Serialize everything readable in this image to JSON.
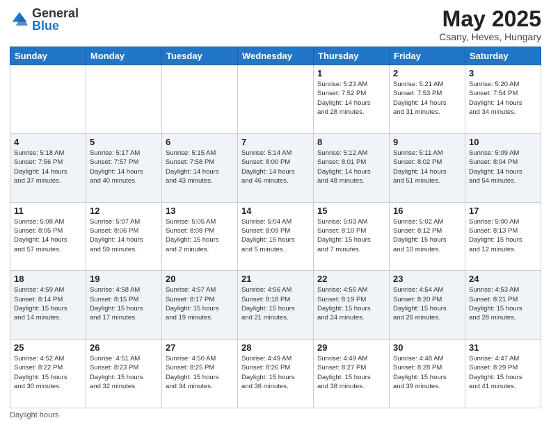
{
  "header": {
    "logo_general": "General",
    "logo_blue": "Blue",
    "month_title": "May 2025",
    "subtitle": "Csany, Heves, Hungary"
  },
  "footer": {
    "daylight_label": "Daylight hours"
  },
  "weekdays": [
    "Sunday",
    "Monday",
    "Tuesday",
    "Wednesday",
    "Thursday",
    "Friday",
    "Saturday"
  ],
  "weeks": [
    [
      {
        "day": "",
        "info": ""
      },
      {
        "day": "",
        "info": ""
      },
      {
        "day": "",
        "info": ""
      },
      {
        "day": "",
        "info": ""
      },
      {
        "day": "1",
        "info": "Sunrise: 5:23 AM\nSunset: 7:52 PM\nDaylight: 14 hours\nand 28 minutes."
      },
      {
        "day": "2",
        "info": "Sunrise: 5:21 AM\nSunset: 7:53 PM\nDaylight: 14 hours\nand 31 minutes."
      },
      {
        "day": "3",
        "info": "Sunrise: 5:20 AM\nSunset: 7:54 PM\nDaylight: 14 hours\nand 34 minutes."
      }
    ],
    [
      {
        "day": "4",
        "info": "Sunrise: 5:18 AM\nSunset: 7:56 PM\nDaylight: 14 hours\nand 37 minutes."
      },
      {
        "day": "5",
        "info": "Sunrise: 5:17 AM\nSunset: 7:57 PM\nDaylight: 14 hours\nand 40 minutes."
      },
      {
        "day": "6",
        "info": "Sunrise: 5:15 AM\nSunset: 7:58 PM\nDaylight: 14 hours\nand 43 minutes."
      },
      {
        "day": "7",
        "info": "Sunrise: 5:14 AM\nSunset: 8:00 PM\nDaylight: 14 hours\nand 46 minutes."
      },
      {
        "day": "8",
        "info": "Sunrise: 5:12 AM\nSunset: 8:01 PM\nDaylight: 14 hours\nand 48 minutes."
      },
      {
        "day": "9",
        "info": "Sunrise: 5:11 AM\nSunset: 8:02 PM\nDaylight: 14 hours\nand 51 minutes."
      },
      {
        "day": "10",
        "info": "Sunrise: 5:09 AM\nSunset: 8:04 PM\nDaylight: 14 hours\nand 54 minutes."
      }
    ],
    [
      {
        "day": "11",
        "info": "Sunrise: 5:08 AM\nSunset: 8:05 PM\nDaylight: 14 hours\nand 57 minutes."
      },
      {
        "day": "12",
        "info": "Sunrise: 5:07 AM\nSunset: 8:06 PM\nDaylight: 14 hours\nand 59 minutes."
      },
      {
        "day": "13",
        "info": "Sunrise: 5:05 AM\nSunset: 8:08 PM\nDaylight: 15 hours\nand 2 minutes."
      },
      {
        "day": "14",
        "info": "Sunrise: 5:04 AM\nSunset: 8:09 PM\nDaylight: 15 hours\nand 5 minutes."
      },
      {
        "day": "15",
        "info": "Sunrise: 5:03 AM\nSunset: 8:10 PM\nDaylight: 15 hours\nand 7 minutes."
      },
      {
        "day": "16",
        "info": "Sunrise: 5:02 AM\nSunset: 8:12 PM\nDaylight: 15 hours\nand 10 minutes."
      },
      {
        "day": "17",
        "info": "Sunrise: 5:00 AM\nSunset: 8:13 PM\nDaylight: 15 hours\nand 12 minutes."
      }
    ],
    [
      {
        "day": "18",
        "info": "Sunrise: 4:59 AM\nSunset: 8:14 PM\nDaylight: 15 hours\nand 14 minutes."
      },
      {
        "day": "19",
        "info": "Sunrise: 4:58 AM\nSunset: 8:15 PM\nDaylight: 15 hours\nand 17 minutes."
      },
      {
        "day": "20",
        "info": "Sunrise: 4:57 AM\nSunset: 8:17 PM\nDaylight: 15 hours\nand 19 minutes."
      },
      {
        "day": "21",
        "info": "Sunrise: 4:56 AM\nSunset: 8:18 PM\nDaylight: 15 hours\nand 21 minutes."
      },
      {
        "day": "22",
        "info": "Sunrise: 4:55 AM\nSunset: 8:19 PM\nDaylight: 15 hours\nand 24 minutes."
      },
      {
        "day": "23",
        "info": "Sunrise: 4:54 AM\nSunset: 8:20 PM\nDaylight: 15 hours\nand 26 minutes."
      },
      {
        "day": "24",
        "info": "Sunrise: 4:53 AM\nSunset: 8:21 PM\nDaylight: 15 hours\nand 28 minutes."
      }
    ],
    [
      {
        "day": "25",
        "info": "Sunrise: 4:52 AM\nSunset: 8:22 PM\nDaylight: 15 hours\nand 30 minutes."
      },
      {
        "day": "26",
        "info": "Sunrise: 4:51 AM\nSunset: 8:23 PM\nDaylight: 15 hours\nand 32 minutes."
      },
      {
        "day": "27",
        "info": "Sunrise: 4:50 AM\nSunset: 8:25 PM\nDaylight: 15 hours\nand 34 minutes."
      },
      {
        "day": "28",
        "info": "Sunrise: 4:49 AM\nSunset: 8:26 PM\nDaylight: 15 hours\nand 36 minutes."
      },
      {
        "day": "29",
        "info": "Sunrise: 4:49 AM\nSunset: 8:27 PM\nDaylight: 15 hours\nand 38 minutes."
      },
      {
        "day": "30",
        "info": "Sunrise: 4:48 AM\nSunset: 8:28 PM\nDaylight: 15 hours\nand 39 minutes."
      },
      {
        "day": "31",
        "info": "Sunrise: 4:47 AM\nSunset: 8:29 PM\nDaylight: 15 hours\nand 41 minutes."
      }
    ]
  ]
}
